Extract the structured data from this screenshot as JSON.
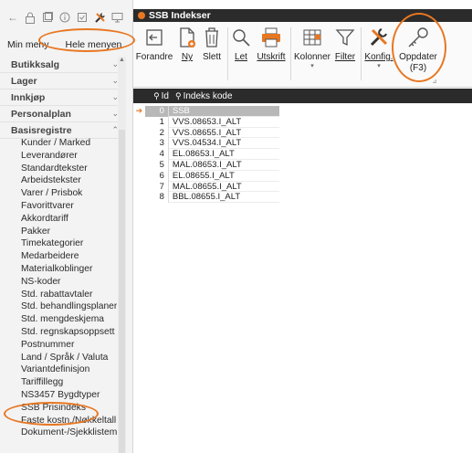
{
  "sidebar": {
    "toolbar_icons": [
      "back-arrow-icon",
      "lock-icon",
      "window-icon",
      "info-icon",
      "checklist-icon",
      "tools-icon",
      "screen-icon"
    ],
    "tabs": [
      "Min meny",
      "Hele menyen"
    ],
    "groups": [
      {
        "label": "Butikksalg"
      },
      {
        "label": "Lager"
      },
      {
        "label": "Innkjøp"
      },
      {
        "label": "Personalplan"
      },
      {
        "label": "Basisregistre"
      }
    ],
    "items": [
      "Kunder / Marked",
      "Leverandører",
      "Standardtekster",
      "Arbeidstekster",
      "Varer / Prisbok",
      "Favorittvarer",
      "Akkordtariff",
      "Pakker",
      "Timekategorier",
      "Medarbeidere",
      "Materialkoblinger",
      "NS-koder",
      "Std. rabattavtaler",
      "Std. behandlingsplaner",
      "Std. mengdeskjema",
      "Std. regnskapsoppsett",
      "Postnummer",
      "Land / Språk / Valuta",
      "Variantdefinisjon",
      "Tariffillegg",
      "NS3457 Bygdtyper",
      "SSB Prisindeks",
      "Faste kostn./Nøkkeltall",
      "Dokument-/Sjekklistemaler"
    ]
  },
  "window": {
    "title": "SSB Indekser"
  },
  "ribbon": {
    "buttons": [
      {
        "label": "Forandre",
        "icon": "edit-icon"
      },
      {
        "label": "Ny",
        "icon": "new-document-icon"
      },
      {
        "label": "Slett",
        "icon": "trash-icon"
      },
      {
        "label": "Let",
        "icon": "search-icon"
      },
      {
        "label": "Utskrift",
        "icon": "printer-icon"
      },
      {
        "label": "Kolonner",
        "icon": "columns-icon"
      },
      {
        "label": "Filter",
        "icon": "filter-icon"
      },
      {
        "label": "Konfig.",
        "icon": "tools-icon"
      },
      {
        "label": "Oppdater",
        "sub": "(F3)",
        "icon": "key-icon"
      }
    ]
  },
  "grid": {
    "columns": [
      "Id",
      "Indeks kode"
    ],
    "rows": [
      {
        "id": "0",
        "kode": "SSB"
      },
      {
        "id": "1",
        "kode": "VVS.08653.I_ALT"
      },
      {
        "id": "2",
        "kode": "VVS.08655.I_ALT"
      },
      {
        "id": "3",
        "kode": "VVS.04534.I_ALT"
      },
      {
        "id": "4",
        "kode": "EL.08653.I_ALT"
      },
      {
        "id": "5",
        "kode": "MAL.08653.I_ALT"
      },
      {
        "id": "6",
        "kode": "EL.08655.I_ALT"
      },
      {
        "id": "7",
        "kode": "MAL.08655.I_ALT"
      },
      {
        "id": "8",
        "kode": "BBL.08655.I_ALT"
      }
    ]
  },
  "colors": {
    "accent": "#e87722",
    "titlebar": "#2b2b2b",
    "selected_row": "#b8b8b8"
  }
}
